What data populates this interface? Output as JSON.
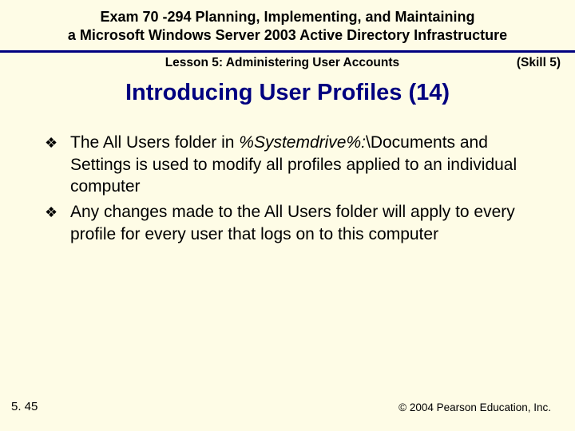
{
  "header": {
    "title_line1": "Exam 70 -294 Planning, Implementing, and Maintaining",
    "title_line2": "a Microsoft Windows Server 2003 Active Directory Infrastructure"
  },
  "subheader": {
    "lesson": "Lesson 5: Administering User Accounts",
    "skill": "(Skill 5)"
  },
  "slide": {
    "title": "Introducing User Profiles (14)"
  },
  "bullets": [
    {
      "pre": "The All Users folder in ",
      "italic": "%Systemdrive%:",
      "post": "\\Documents and Settings is used to modify all profiles applied to an individual computer"
    },
    {
      "pre": "Any changes made to the All Users folder will apply to every profile for every user that logs on to this computer",
      "italic": "",
      "post": ""
    }
  ],
  "footer": {
    "page": "5. 45",
    "copyright": "© 2004 Pearson Education, Inc."
  }
}
